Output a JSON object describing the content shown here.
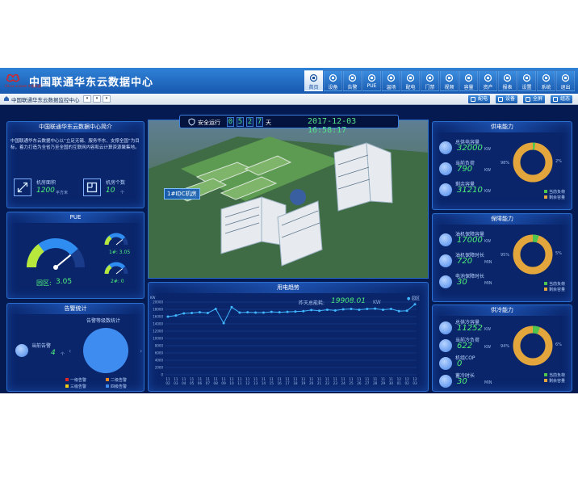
{
  "header": {
    "logo_text": "China unicom 中国联通",
    "title": "中国联通华东云数据中心",
    "nav": [
      {
        "label": "首页",
        "icon": "home-icon",
        "active": true
      },
      {
        "label": "设备",
        "icon": "device-icon"
      },
      {
        "label": "告警",
        "icon": "alarm-icon"
      },
      {
        "label": "PUE",
        "icon": "pue-icon"
      },
      {
        "label": "温场",
        "icon": "thermometer-icon"
      },
      {
        "label": "配电",
        "icon": "power-icon"
      },
      {
        "label": "门禁",
        "icon": "door-icon"
      },
      {
        "label": "视频",
        "icon": "video-icon"
      },
      {
        "label": "容量",
        "icon": "capacity-icon"
      },
      {
        "label": "资产",
        "icon": "asset-icon"
      },
      {
        "label": "报表",
        "icon": "report-icon"
      },
      {
        "label": "设置",
        "icon": "settings-icon"
      },
      {
        "label": "系统",
        "icon": "system-icon"
      },
      {
        "label": "退出",
        "icon": "logout-icon"
      }
    ]
  },
  "toolbar": {
    "title": "中国联通华东云数据监控中心",
    "buttons": [
      {
        "label": "配电",
        "icon": "distribution-icon"
      },
      {
        "label": "设备",
        "icon": "device-icon"
      },
      {
        "label": "全屏",
        "icon": "fullscreen-icon"
      },
      {
        "label": "组态",
        "icon": "config-icon"
      }
    ]
  },
  "intro": {
    "title": "中国联通华东云数据中心简介",
    "text": "中国联通华东云数据中心以“立足无锡、服务华东、支撑全国”为目标，着力打造为全省乃至全国的互联网内容和云计算资源聚集地。",
    "area_label": "机房面积",
    "area_value": "1200",
    "area_unit": "平方米",
    "rooms_label": "机房个数",
    "rooms_value": "10",
    "rooms_unit": "个"
  },
  "pue": {
    "title": "PUE",
    "park_label": "园区:",
    "park_value": "3.05",
    "park_level": 0.78,
    "g1_label": "1#: 3.05",
    "g1_level": 0.78,
    "g2_label": "2#: 0",
    "g2_level": 0.78
  },
  "alarm": {
    "title": "告警统计",
    "current_label": "当前告警",
    "current_value": "4",
    "current_unit": "个",
    "chart_title": "告警等级数统计",
    "legend": [
      {
        "label": "一级告警",
        "color": "#e02626"
      },
      {
        "label": "二级告警",
        "color": "#f08a24"
      },
      {
        "label": "三级告警",
        "color": "#f4d10f"
      },
      {
        "label": "四级告警",
        "color": "#3f8cf0"
      }
    ],
    "levels": [
      0,
      0,
      0,
      4
    ]
  },
  "center": {
    "safe_label": "安全运行",
    "days": [
      "0",
      "5",
      "2",
      "7"
    ],
    "day_unit": "天",
    "datetime": "2017-12-03 16:58:17",
    "building_label": "1#IDC机房"
  },
  "power_trend": {
    "title": "用电趋势",
    "yesterday_label": "昨天总能耗:",
    "yesterday_value": "19908.01",
    "yesterday_unit": "KW",
    "legend": "园区"
  },
  "chart_data": {
    "type": "line",
    "ylabel": "KW",
    "yticks": [
      "20000",
      "18000",
      "16000",
      "14000",
      "12000",
      "10000",
      "8000",
      "6000",
      "4000",
      "2000",
      "0"
    ],
    "ylim": [
      0,
      20000
    ],
    "x": [
      "11 02",
      "11 03",
      "11 04",
      "11 05",
      "11 06",
      "11 07",
      "11 08",
      "11 09",
      "11 10",
      "11 11",
      "11 12",
      "11 13",
      "11 14",
      "11 15",
      "11 16",
      "11 17",
      "11 18",
      "11 19",
      "11 20",
      "11 21",
      "11 22",
      "11 23",
      "11 24",
      "11 25",
      "11 26",
      "11 27",
      "11 28",
      "11 29",
      "11 30",
      "12 01",
      "12 02",
      "12 03"
    ],
    "series": [
      {
        "name": "园区",
        "values": [
          16000,
          16300,
          16900,
          17000,
          17200,
          17000,
          18100,
          14200,
          18600,
          17100,
          17200,
          17100,
          17100,
          17300,
          17200,
          17300,
          17400,
          17500,
          17800,
          17600,
          17900,
          17700,
          18000,
          18100,
          17900,
          18100,
          18200,
          17900,
          18100,
          17500,
          17600,
          19400
        ]
      }
    ],
    "color": "#3fb6ff"
  },
  "supply": {
    "title": "供电能力",
    "items": [
      {
        "label": "总供电容量",
        "value": "32000",
        "unit": "KW"
      },
      {
        "label": "当前负荷",
        "value": "790",
        "unit": "KW"
      },
      {
        "label": "剩余容量",
        "value": "31210",
        "unit": "KW"
      }
    ],
    "donut_left": "98%",
    "donut_right": "2%",
    "fraction": 0.02,
    "legend_current": "当前负荷",
    "legend_remaining": "剩余容量"
  },
  "backup": {
    "title": "保障能力",
    "items": [
      {
        "label": "油机保障容量",
        "value": "17000",
        "unit": "KW"
      },
      {
        "label": "油机保障时长",
        "value": "720",
        "unit": "MIN"
      },
      {
        "label": "电池保障时长",
        "value": "30",
        "unit": "MIN"
      }
    ],
    "donut_left": "95%",
    "donut_right": "5%",
    "fraction": 0.05,
    "legend_current": "当前负荷",
    "legend_remaining": "剩余容量"
  },
  "cooling": {
    "title": "供冷能力",
    "items": [
      {
        "label": "总供冷容量",
        "value": "11252",
        "unit": "KW"
      },
      {
        "label": "当前冷负荷",
        "value": "622",
        "unit": "KW"
      },
      {
        "label": "机组COP",
        "value": "0",
        "unit": ""
      },
      {
        "label": "蓄冷时长",
        "value": "30",
        "unit": "MIN"
      }
    ],
    "donut_left": "94%",
    "donut_right": "6%",
    "fraction": 0.06,
    "legend_current": "当前负荷",
    "legend_remaining": "剩余容量"
  }
}
